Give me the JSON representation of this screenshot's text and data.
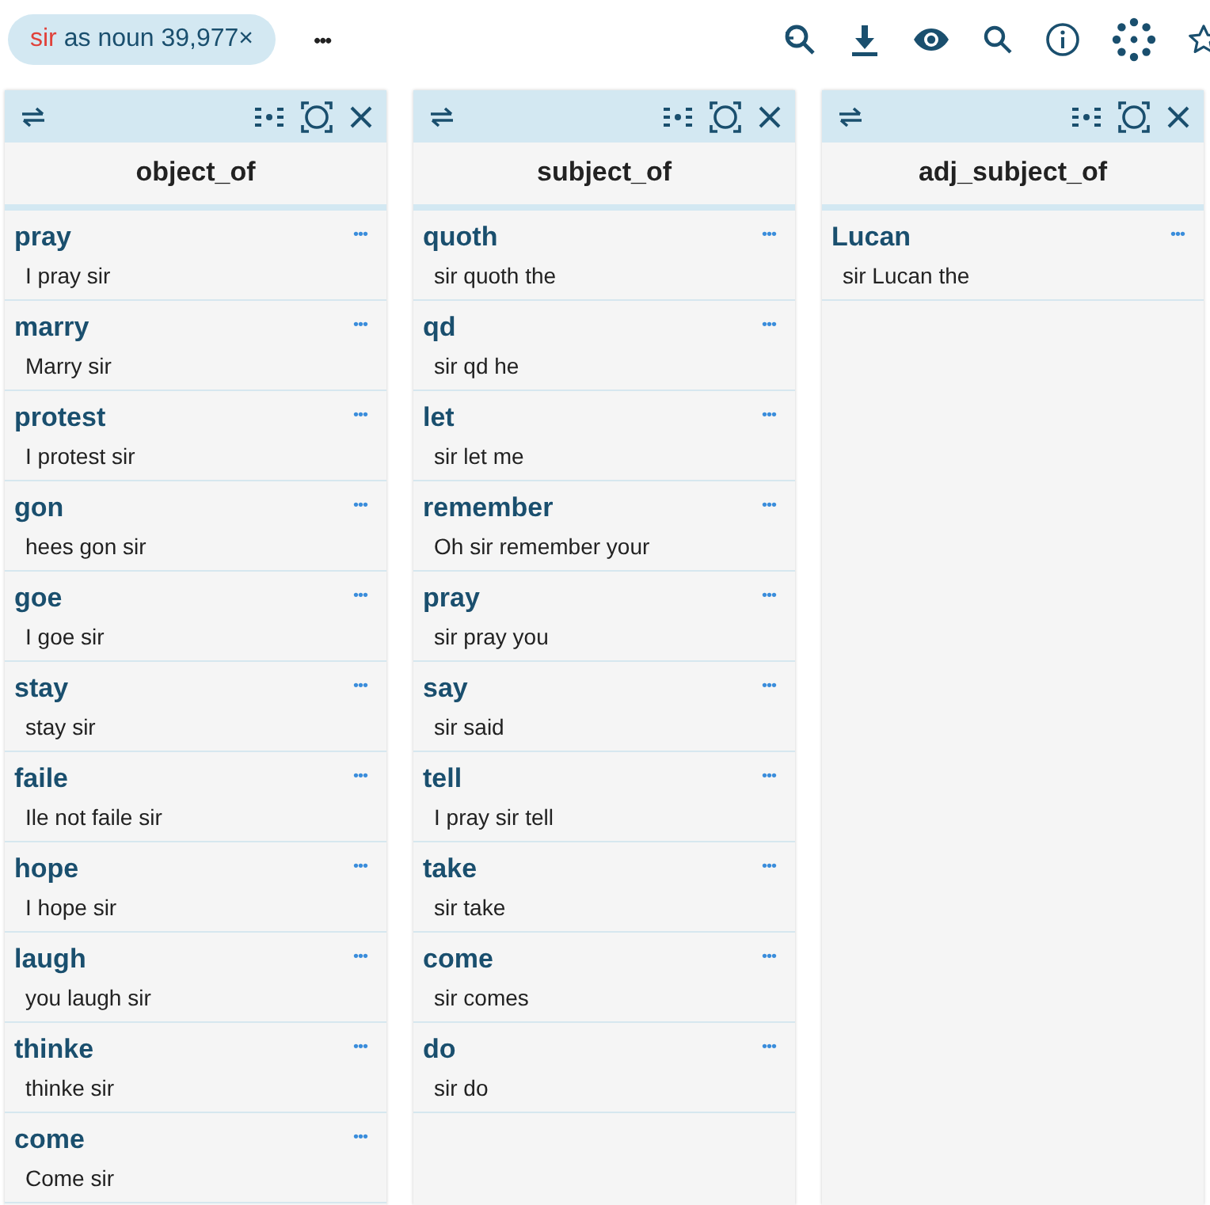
{
  "query_chip": {
    "word": "sir",
    "label": "as noun 39,977×"
  },
  "more": "•••",
  "columns": [
    {
      "title": "object_of",
      "items": [
        {
          "word": "pray",
          "example": "I pray sir"
        },
        {
          "word": "marry",
          "example": "Marry sir"
        },
        {
          "word": "protest",
          "example": "I protest sir"
        },
        {
          "word": "gon",
          "example": "hees gon sir"
        },
        {
          "word": "goe",
          "example": "I goe sir"
        },
        {
          "word": "stay",
          "example": "stay sir"
        },
        {
          "word": "faile",
          "example": "Ile not faile sir"
        },
        {
          "word": "hope",
          "example": "I hope sir"
        },
        {
          "word": "laugh",
          "example": "you laugh sir"
        },
        {
          "word": "thinke",
          "example": "thinke sir"
        },
        {
          "word": "come",
          "example": "Come sir"
        }
      ]
    },
    {
      "title": "subject_of",
      "items": [
        {
          "word": "quoth",
          "example": "sir quoth the"
        },
        {
          "word": "qd",
          "example": "sir qd he"
        },
        {
          "word": "let",
          "example": "sir let me"
        },
        {
          "word": "remember",
          "example": "Oh sir remember your"
        },
        {
          "word": "pray",
          "example": "sir pray you"
        },
        {
          "word": "say",
          "example": "sir said"
        },
        {
          "word": "tell",
          "example": "I pray sir tell"
        },
        {
          "word": "take",
          "example": "sir take"
        },
        {
          "word": "come",
          "example": "sir comes"
        },
        {
          "word": "do",
          "example": "sir do"
        }
      ]
    },
    {
      "title": "adj_subject_of",
      "items": [
        {
          "word": "Lucan",
          "example": "sir Lucan the"
        }
      ]
    }
  ]
}
